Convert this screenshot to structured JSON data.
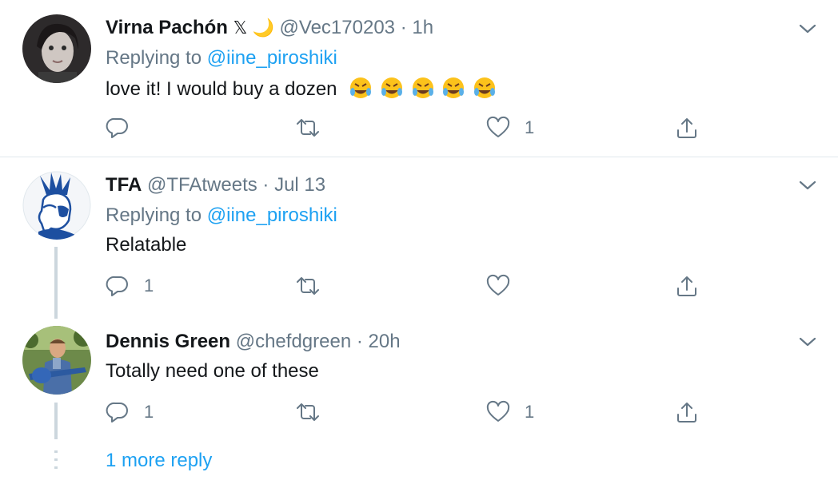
{
  "tweets": [
    {
      "name": "Virna Pachón",
      "name_extra": "𝕏 🌙",
      "handle": "@Vec170203",
      "separator": "·",
      "time": "1h",
      "replying_prefix": "Replying to",
      "replying_to": "@iine_piroshiki",
      "text": "love it! I would buy a dozen",
      "emoji": "🤣🤣🤣🤣🤣",
      "reply_count": "",
      "retweet_count": "",
      "like_count": "1"
    },
    {
      "name": "TFA",
      "handle": "@TFAtweets",
      "separator": "·",
      "time": "Jul 13",
      "replying_prefix": "Replying to",
      "replying_to": "@iine_piroshiki",
      "text": "Relatable",
      "reply_count": "1",
      "retweet_count": "",
      "like_count": ""
    },
    {
      "name": "Dennis Green",
      "handle": "@chefdgreen",
      "separator": "·",
      "time": "20h",
      "text": "Totally need one of these",
      "reply_count": "1",
      "retweet_count": "",
      "like_count": "1"
    }
  ],
  "more_replies": "1 more reply",
  "colors": {
    "link": "#1da1f2",
    "secondary_text": "#657786",
    "divider": "#e1e8ed",
    "thread_line": "#ccd6dd"
  },
  "icons": [
    "reply-icon",
    "retweet-icon",
    "like-icon",
    "share-icon",
    "chevron-down-icon"
  ]
}
